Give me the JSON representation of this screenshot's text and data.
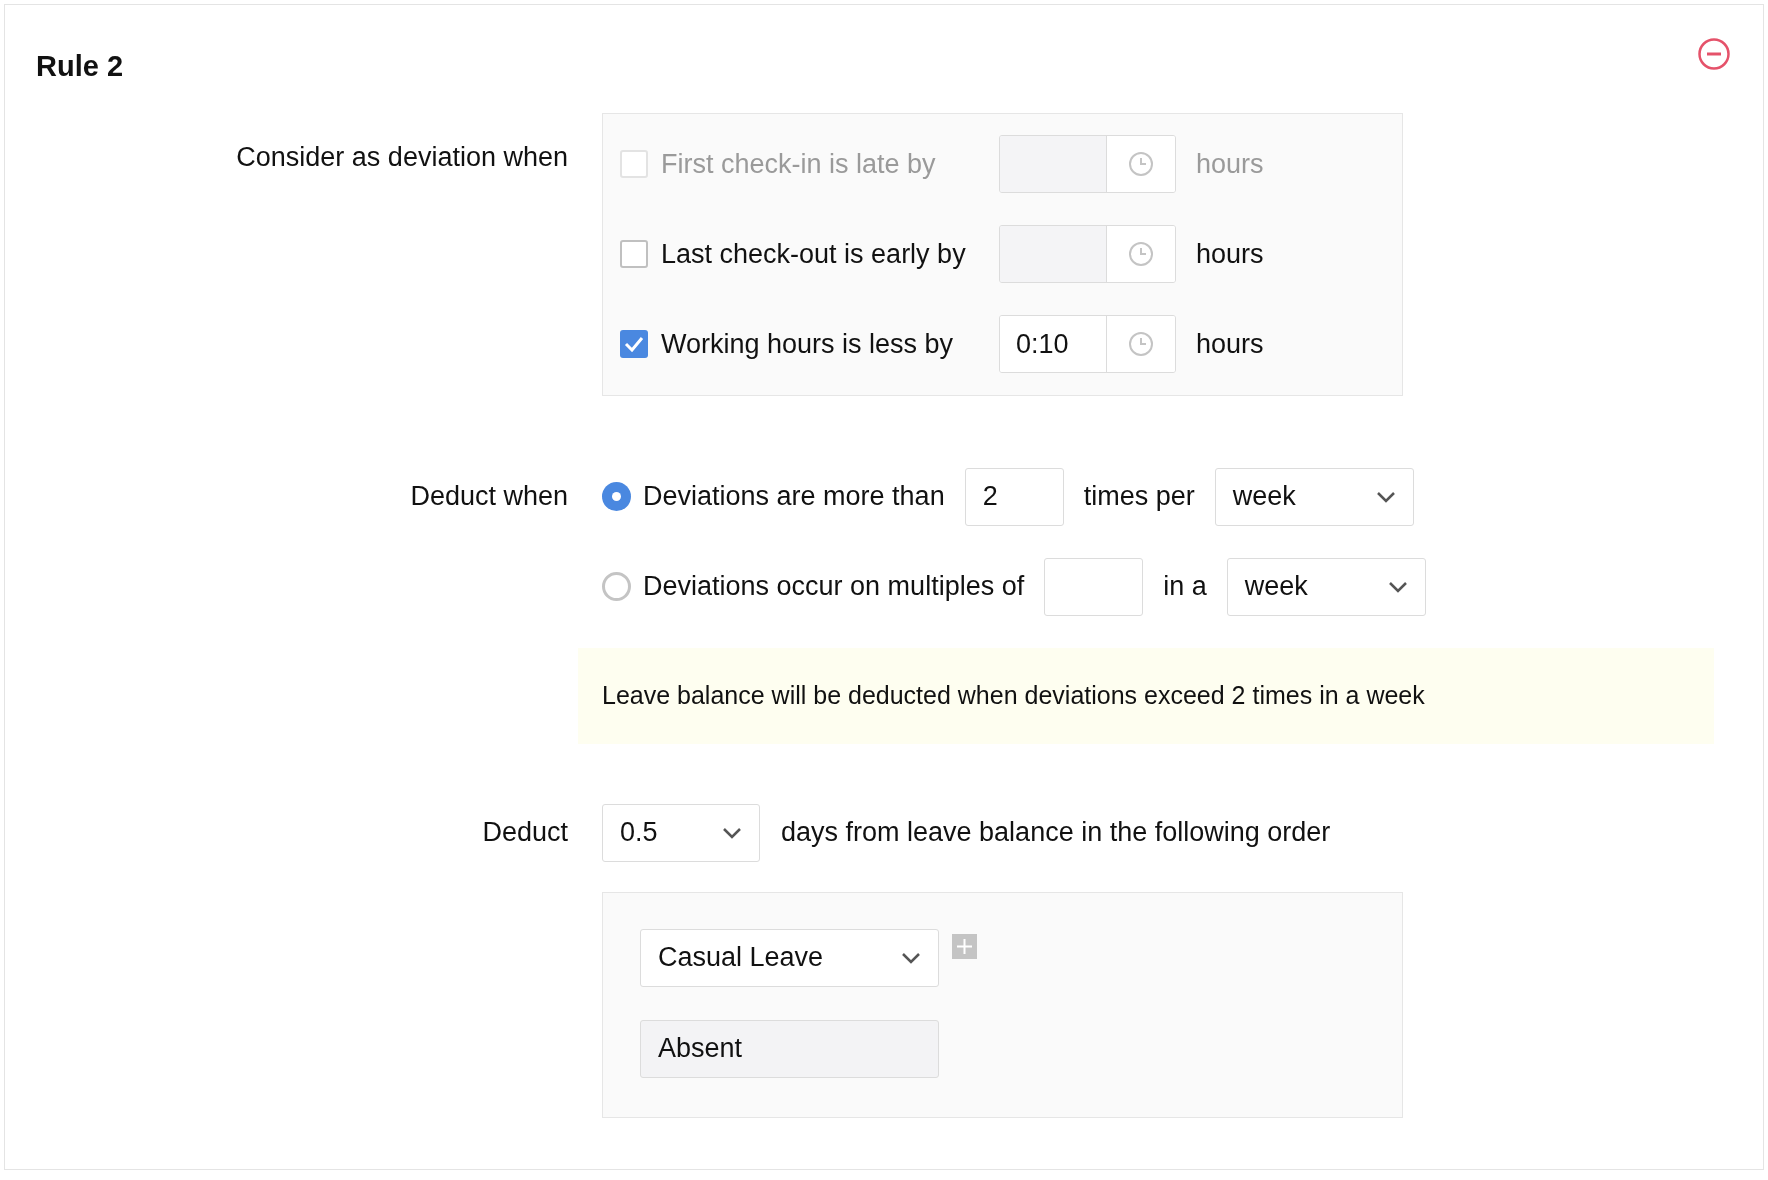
{
  "rule": {
    "title": "Rule 2"
  },
  "deviation": {
    "label": "Consider as deviation when",
    "criteria": [
      {
        "label": "First check-in is late by",
        "checked": false,
        "disabled": true,
        "unit": "hours"
      },
      {
        "label": "Last check-out is early by",
        "checked": false,
        "disabled": false,
        "unit": "hours"
      },
      {
        "label": "Working hours is less by",
        "checked": true,
        "disabled": false,
        "value": "0:10",
        "unit": "hours"
      }
    ]
  },
  "deduct_when": {
    "label": "Deduct when",
    "options": [
      {
        "label": "Deviations are more than",
        "selected": true,
        "count": "2",
        "connector": "times per",
        "period": "week"
      },
      {
        "label": "Deviations occur on multiples of",
        "selected": false,
        "connector": "in a",
        "period": "week"
      }
    ],
    "note": "Leave balance will be deducted when deviations exceed 2 times in a week"
  },
  "deduct": {
    "label": "Deduct",
    "amount": "0.5",
    "text": "days from leave balance in the following order",
    "order": [
      {
        "kind": "select",
        "label": "Casual Leave"
      },
      {
        "kind": "fixed",
        "label": "Absent"
      }
    ]
  }
}
